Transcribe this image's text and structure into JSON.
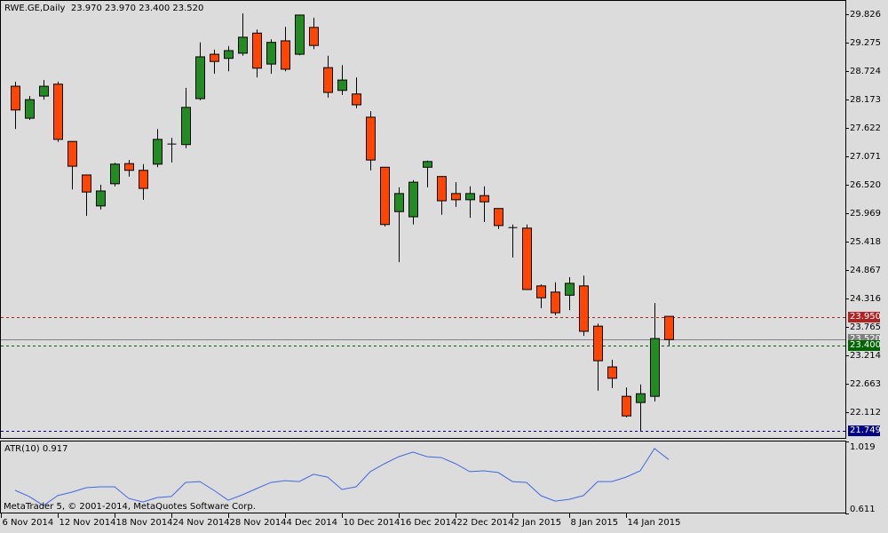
{
  "header": {
    "symbol": "RWE.GE,Daily",
    "open": "23.970",
    "high": "23.970",
    "low": "23.400",
    "close": "23.520"
  },
  "indicator": {
    "name": "ATR(10)",
    "value": "0.917",
    "axis_top": "1.019",
    "axis_bottom": "0.611"
  },
  "copyright": "MetaTrader 5, © 2001-2014, MetaQuotes Software Corp.",
  "colors": {
    "bull": "#228b22",
    "bear": "#ff4500",
    "atr": "#4169e1",
    "background": "#dcdcdc"
  },
  "price_lines": [
    {
      "name": "ask-line",
      "value": 23.95,
      "label": "23.950",
      "color": "#b22222",
      "style": "dashed"
    },
    {
      "name": "last-line",
      "value": 23.52,
      "label": "23.520",
      "color": "#808080",
      "style": "solid"
    },
    {
      "name": "bid-line",
      "value": 23.4,
      "label": "23.400",
      "color": "#006400",
      "style": "dashed"
    },
    {
      "name": "low-line",
      "value": 21.749,
      "label": "21.749",
      "color": "#00008b",
      "style": "dashed"
    }
  ],
  "chart_data": {
    "type": "candlestick",
    "title": "RWE.GE,Daily",
    "ylim": [
      21.6,
      29.9
    ],
    "y_ticks": [
      "29.826",
      "29.275",
      "28.724",
      "28.173",
      "27.622",
      "27.071",
      "26.520",
      "25.969",
      "25.418",
      "24.867",
      "24.316",
      "23.765",
      "23.214",
      "22.663",
      "22.112"
    ],
    "x_ticks": [
      {
        "label": "6 Nov 2014",
        "index": -1
      },
      {
        "label": "12 Nov 2014",
        "index": 3
      },
      {
        "label": "18 Nov 2014",
        "index": 7
      },
      {
        "label": "24 Nov 2014",
        "index": 11
      },
      {
        "label": "28 Nov 2014",
        "index": 15
      },
      {
        "label": "4 Dec 2014",
        "index": 19
      },
      {
        "label": "10 Dec 2014",
        "index": 23
      },
      {
        "label": "16 Dec 2014",
        "index": 27
      },
      {
        "label": "22 Dec 2014",
        "index": 31
      },
      {
        "label": "2 Jan 2015",
        "index": 35
      },
      {
        "label": "8 Jan 2015",
        "index": 39
      },
      {
        "label": "14 Jan 2015",
        "index": 43
      }
    ],
    "ohlc": [
      [
        28.43,
        28.52,
        27.6,
        27.97
      ],
      [
        27.81,
        28.24,
        27.78,
        28.17
      ],
      [
        28.24,
        28.55,
        28.17,
        28.43
      ],
      [
        28.47,
        28.52,
        27.35,
        27.4
      ],
      [
        27.36,
        27.36,
        26.43,
        26.88
      ],
      [
        26.71,
        26.71,
        25.92,
        26.38
      ],
      [
        26.11,
        26.52,
        26.04,
        26.4
      ],
      [
        26.54,
        26.95,
        26.49,
        26.92
      ],
      [
        26.93,
        27.0,
        26.68,
        26.8
      ],
      [
        26.8,
        26.92,
        26.23,
        26.45
      ],
      [
        26.92,
        27.6,
        26.86,
        27.4
      ],
      [
        27.3,
        27.43,
        26.95,
        27.31
      ],
      [
        27.3,
        28.4,
        27.23,
        28.02
      ],
      [
        28.19,
        29.28,
        28.16,
        29.0
      ],
      [
        29.05,
        29.14,
        28.67,
        28.91
      ],
      [
        28.97,
        29.21,
        28.72,
        29.12
      ],
      [
        29.07,
        29.84,
        29.02,
        29.38
      ],
      [
        29.46,
        29.53,
        28.6,
        28.78
      ],
      [
        28.86,
        29.34,
        28.67,
        29.28
      ],
      [
        29.31,
        29.58,
        28.72,
        28.76
      ],
      [
        29.05,
        29.81,
        29.03,
        29.81
      ],
      [
        29.57,
        29.76,
        29.15,
        29.22
      ],
      [
        28.79,
        29.02,
        28.21,
        28.31
      ],
      [
        28.35,
        28.84,
        28.26,
        28.55
      ],
      [
        28.28,
        28.6,
        28.0,
        28.07
      ],
      [
        27.83,
        27.95,
        26.8,
        27.0
      ],
      [
        26.86,
        26.86,
        25.71,
        25.75
      ],
      [
        26.0,
        26.47,
        25.02,
        26.35
      ],
      [
        25.9,
        26.61,
        25.75,
        26.57
      ],
      [
        26.86,
        26.99,
        26.47,
        26.97
      ],
      [
        26.68,
        26.69,
        25.94,
        26.21
      ],
      [
        26.35,
        26.57,
        26.09,
        26.23
      ],
      [
        26.23,
        26.49,
        25.88,
        26.35
      ],
      [
        26.31,
        26.49,
        25.8,
        26.19
      ],
      [
        26.06,
        26.06,
        25.66,
        25.73
      ],
      [
        25.69,
        25.75,
        25.11,
        25.69
      ],
      [
        25.68,
        25.75,
        24.49,
        24.49
      ],
      [
        24.56,
        24.59,
        24.13,
        24.33
      ],
      [
        24.44,
        24.63,
        23.99,
        24.04
      ],
      [
        24.38,
        24.73,
        24.09,
        24.61
      ],
      [
        24.56,
        24.76,
        23.59,
        23.68
      ],
      [
        23.78,
        23.83,
        22.53,
        23.11
      ],
      [
        22.99,
        23.13,
        22.58,
        22.77
      ],
      [
        22.42,
        22.59,
        22.01,
        22.04
      ],
      [
        22.3,
        22.65,
        21.75,
        22.47
      ],
      [
        22.42,
        24.23,
        22.32,
        23.54
      ],
      [
        23.97,
        23.97,
        23.4,
        23.52
      ]
    ],
    "atr": [
      0.742,
      0.707,
      0.656,
      0.712,
      0.732,
      0.757,
      0.762,
      0.762,
      0.696,
      0.676,
      0.701,
      0.707,
      0.787,
      0.792,
      0.742,
      0.686,
      0.717,
      0.752,
      0.787,
      0.797,
      0.792,
      0.833,
      0.817,
      0.747,
      0.762,
      0.848,
      0.893,
      0.933,
      0.959,
      0.933,
      0.928,
      0.893,
      0.848,
      0.853,
      0.843,
      0.792,
      0.787,
      0.712,
      0.681,
      0.691,
      0.712,
      0.792,
      0.792,
      0.817,
      0.853,
      0.979,
      0.917
    ],
    "atr_ylim": [
      0.611,
      1.019
    ]
  }
}
